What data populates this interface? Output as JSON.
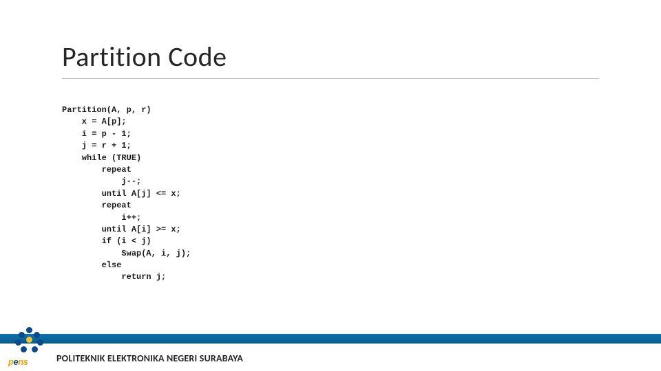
{
  "slide": {
    "title": "Partition Code",
    "code": "Partition(A, p, r)\n    x = A[p];\n    i = p - 1;\n    j = r + 1;\n    while (TRUE)\n        repeat\n            j--;\n        until A[j] <= x;\n        repeat\n            i++;\n        until A[i] >= x;\n        if (i < j)\n            Swap(A, i, j);\n        else\n            return j;"
  },
  "footer": {
    "institution": "POLITEKNIK ELEKTRONIKA NEGERI SURABAYA",
    "logo_text_1": "p",
    "logo_text_2": "e",
    "logo_text_3": "ns"
  },
  "colors": {
    "footer_bar": "#0a6aa1",
    "logo_blue": "#0a4a8a",
    "logo_yellow": "#f4c430",
    "logo_orange": "#f4a000"
  }
}
